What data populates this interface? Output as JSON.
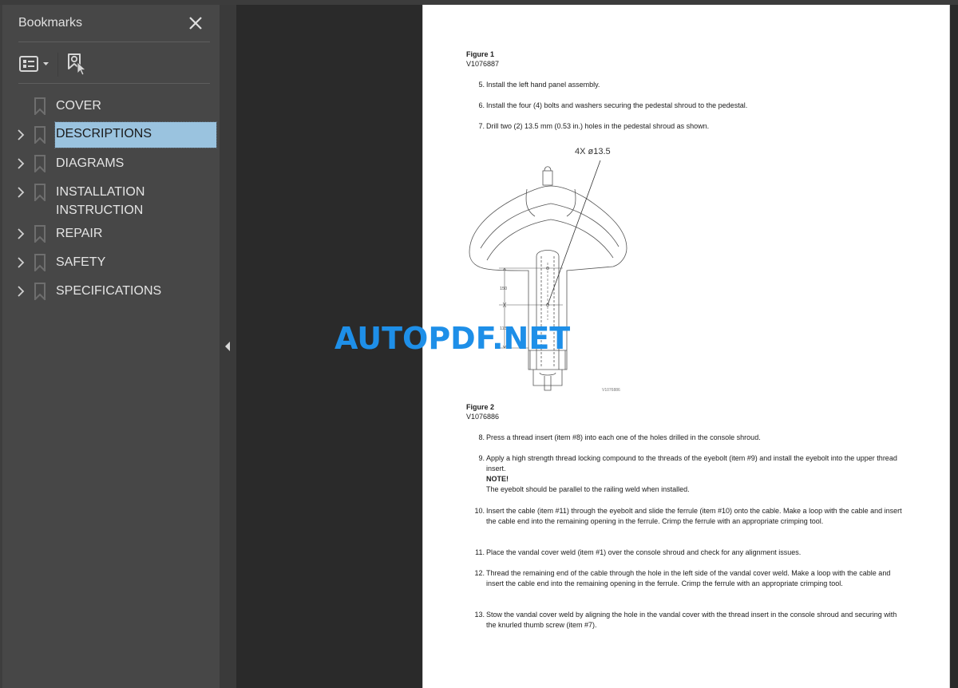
{
  "sidebar": {
    "title": "Bookmarks",
    "close_label": "Close",
    "toolbar": {
      "options_icon": "list-options-icon",
      "find_icon": "find-current-bookmark-icon"
    },
    "items": [
      {
        "label": "COVER",
        "expandable": false,
        "selected": false
      },
      {
        "label": "DESCRIPTIONS",
        "expandable": true,
        "selected": true
      },
      {
        "label": "DIAGRAMS",
        "expandable": true,
        "selected": false
      },
      {
        "label": "INSTALLATION INSTRUCTION",
        "line1": "INSTALLATION",
        "line2": "INSTRUCTION",
        "expandable": true,
        "selected": false
      },
      {
        "label": "REPAIR",
        "expandable": true,
        "selected": false
      },
      {
        "label": "SAFETY",
        "expandable": true,
        "selected": false
      },
      {
        "label": "SPECIFICATIONS",
        "expandable": true,
        "selected": false
      }
    ],
    "selected_color": "#9ac3df"
  },
  "document": {
    "figure1": {
      "title": "Figure 1",
      "code": "V1076887"
    },
    "steps_a": [
      {
        "num": "5.",
        "text": "Install the left hand panel assembly."
      },
      {
        "num": "6.",
        "text": "Install the four (4) bolts and washers securing the pedestal shroud to the pedestal."
      },
      {
        "num": "7.",
        "text": "Drill two (2) 13.5 mm (0.53 in.) holes in the pedestal shroud as shown."
      }
    ],
    "drawing": {
      "callout": "4X ø13.5",
      "dim_upper": "150",
      "dim_lower": "115",
      "code": "V1076886"
    },
    "figure2": {
      "title": "Figure 2",
      "code": "V1076886"
    },
    "steps_b": [
      {
        "num": "8.",
        "text": "Press a thread insert (item #8) into each one of the holes drilled in the console shroud."
      },
      {
        "num": "9.",
        "text": "Apply a high strength thread locking compound to the threads of the eyebolt (item #9) and install the eyebolt into the upper thread insert.",
        "note_title": "NOTE!",
        "note_text": "The eyebolt should be parallel to the railing weld when installed."
      },
      {
        "num": "10.",
        "text": "Insert the cable (item #11) through the eyebolt and slide the ferrule (item #10) onto the cable. Make a loop with the cable and insert the cable end into the remaining opening in the ferrule. Crimp the ferrule with an appropriate crimping tool."
      },
      {
        "num": "11.",
        "text": "Place the vandal cover weld (item #1) over the console shroud and check for any alignment issues."
      },
      {
        "num": "12.",
        "text": "Thread the remaining end of the cable through the hole in the left side of the vandal cover weld. Make a loop with the cable and insert the cable end into the remaining opening in the ferrule. Crimp the ferrule with an appropriate crimping tool."
      },
      {
        "num": "13.",
        "text": "Stow the vandal cover weld by aligning the hole in the vandal cover with the thread insert in the console shroud and securing with the knurled thumb screw (item #7)."
      }
    ]
  },
  "watermark": {
    "text": "AUTOPDF.NET",
    "color": "#1e8fe8"
  }
}
